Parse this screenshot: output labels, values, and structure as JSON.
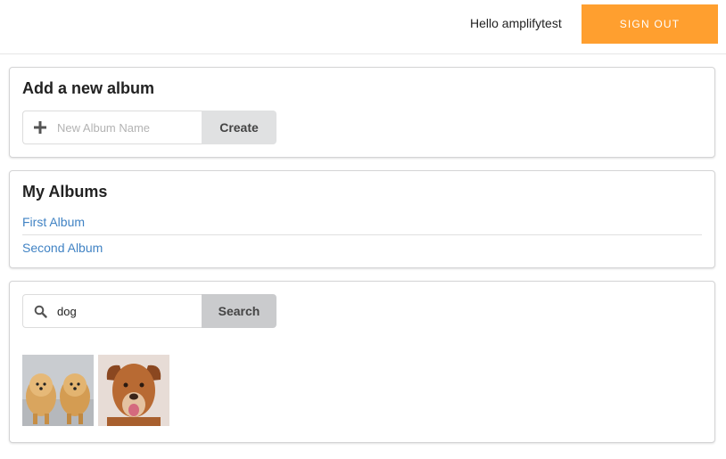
{
  "header": {
    "greeting": "Hello amplifytest",
    "signout_label": "SIGN OUT"
  },
  "add_album": {
    "title": "Add a new album",
    "input_placeholder": "New Album Name",
    "input_value": "",
    "create_label": "Create"
  },
  "my_albums": {
    "title": "My Albums",
    "items": [
      {
        "label": "First Album"
      },
      {
        "label": "Second Album"
      }
    ]
  },
  "search": {
    "input_value": "dog",
    "search_label": "Search",
    "results": [
      {
        "icon": "pomeranian-dogs-photo"
      },
      {
        "icon": "retriever-dog-photo"
      }
    ]
  },
  "colors": {
    "accent": "#ff9f2f",
    "link": "#4183c4"
  }
}
